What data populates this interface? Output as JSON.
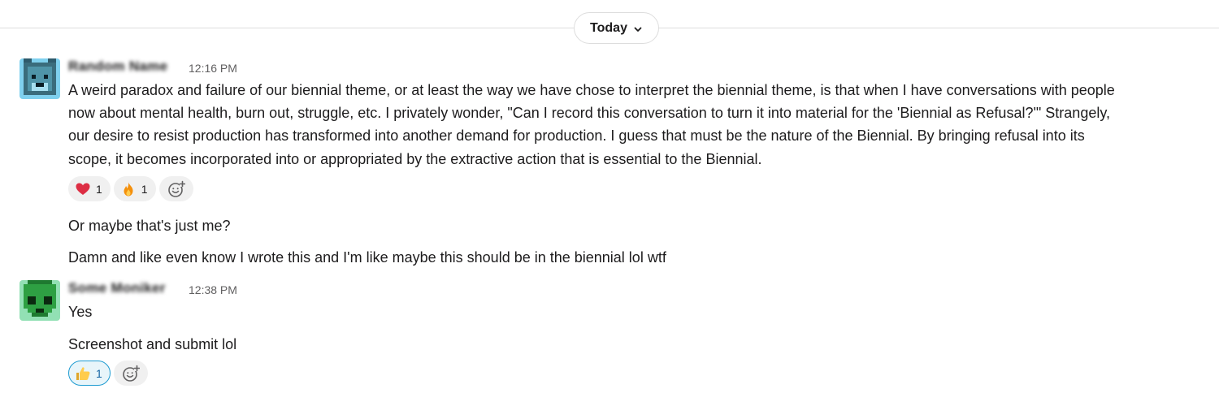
{
  "divider": {
    "label": "Today"
  },
  "messages": [
    {
      "author": "Random Name",
      "time": "12:16 PM",
      "lines": [
        "A weird paradox and failure of our biennial theme, or at least the way we have chose to interpret the biennial theme, is that when I have conversations with people",
        "now about mental health, burn out, struggle, etc. I privately wonder, \"Can I record this conversation to turn it into material for the 'Biennial as Refusal?'\" Strangely,",
        "our desire to resist production has transformed into another demand for production. I guess that must be the nature of the Biennial. By bringing refusal into its",
        "scope, it becomes incorporated into or appropriated by the extractive action that is essential to the Biennial."
      ],
      "reactions": [
        {
          "emoji": "heart",
          "count": "1"
        },
        {
          "emoji": "fire",
          "count": "1"
        }
      ],
      "followups": [
        "Or maybe that's just me?",
        "Damn and like even know I wrote this and I'm like maybe this should be in the biennial lol wtf"
      ]
    },
    {
      "author": "Some Moniker",
      "time": "12:38 PM",
      "lines": [
        "Yes"
      ],
      "followups": [
        "Screenshot and submit lol"
      ],
      "reactions": [
        {
          "emoji": "thumbs-up",
          "count": "1",
          "active": true
        }
      ]
    }
  ],
  "colors": {
    "accent": "#1d9bd1",
    "text": "#1d1c1d",
    "muted": "#616061",
    "divider": "#dddddd"
  }
}
